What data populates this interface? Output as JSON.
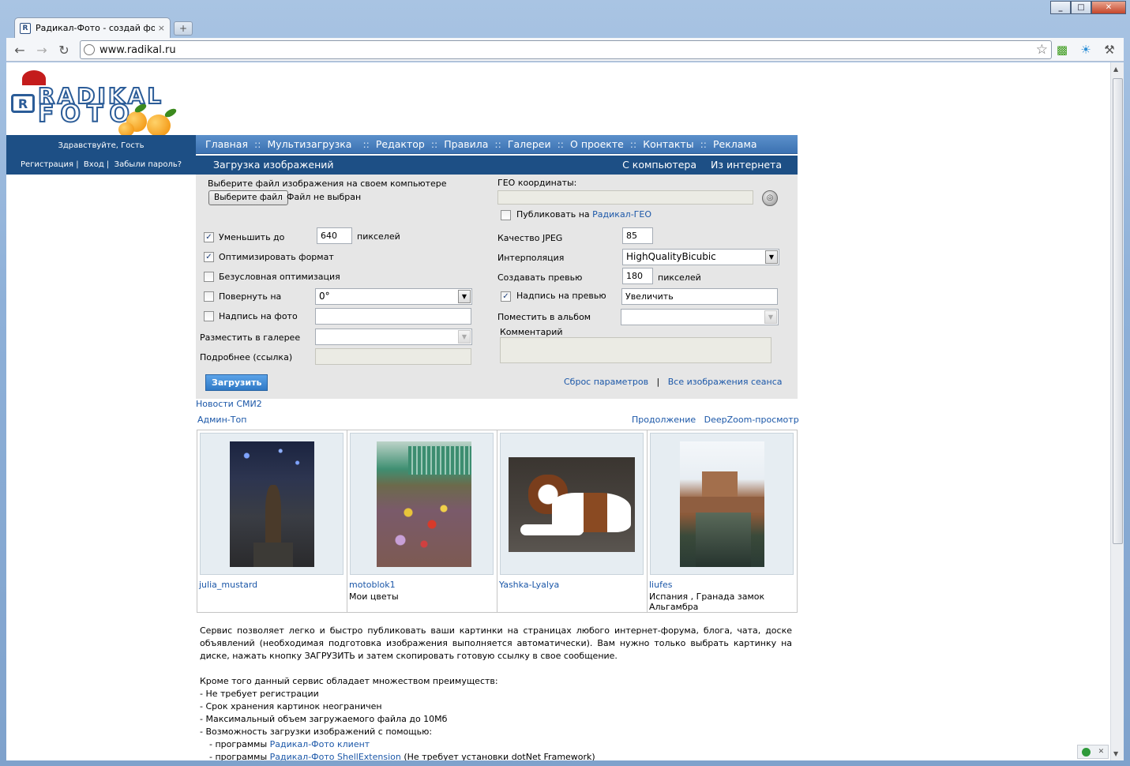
{
  "browser": {
    "tab_title": "Радикал-Фото - создай фо",
    "tab_close": "×",
    "newtab": "+",
    "url": "www.radikal.ru",
    "win_min": "_",
    "win_max": "□",
    "win_close": "✕"
  },
  "icons": {
    "back": "arrow-left-icon",
    "forward": "arrow-right-icon",
    "reload": "reload-icon",
    "star": "bookmark-star-icon",
    "wrench": "wrench-icon"
  },
  "header": {
    "greeting": "Здравствуйте, Гость",
    "register": "Регистрация",
    "login": "Вход",
    "forgot": "Забыли пароль?",
    "sep": "|"
  },
  "topnav": [
    "Главная",
    "Мультизагрузка",
    "Редактор",
    "Правила",
    "Галереи",
    "О проекте",
    "Контакты",
    "Реклама"
  ],
  "topnav_sep": "::",
  "subnav": {
    "title": "Загрузка изображений",
    "from_computer": "С компьютера",
    "from_internet": "Из интернета"
  },
  "form": {
    "choose_label": "Выберите файл изображения на своем компьютере",
    "choose_button": "Выберите файл",
    "no_file": "Файл не выбран",
    "resize_label": "Уменьшить до",
    "resize_value": "640",
    "pixels": "пикселей",
    "optimize_format": "Оптимизировать формат",
    "force_optimize": "Безусловная оптимизация",
    "rotate_label": "Повернуть на",
    "rotate_value": "0°",
    "caption_label": "Надпись на фото",
    "gallery_label": "Разместить в галерее",
    "details_label": "Подробнее (ссылка)",
    "upload_button": "Загрузить",
    "geo_label": "ГЕО координаты:",
    "publish_geo": "Публиковать на",
    "publish_geo_link": "Радикал-ГЕО",
    "jpeg_label": "Качество JPEG",
    "jpeg_value": "85",
    "interp_label": "Интерполяция",
    "interp_value": "HighQualityBicubic",
    "preview_label": "Создавать превью",
    "preview_value": "180",
    "preview_caption_label": "Надпись на превью",
    "preview_caption_value": "Увеличить",
    "album_label": "Поместить в альбом",
    "comment_label": "Комментарий",
    "reset_link": "Сброс параметров",
    "all_images_link": "Все изображения сеанса",
    "links_sep": "|",
    "check": "✓"
  },
  "news_link": "Новости СМИ2",
  "admin_top": "Админ-Топ",
  "continue_link": "Продолжение",
  "deepzoom_link": "DeepZoom-просмотр",
  "gallery": [
    {
      "author": "julia_mustard",
      "caption": ""
    },
    {
      "author": "motoblok1",
      "caption": "Мои цветы"
    },
    {
      "author": "Yashka-Lyalya",
      "caption": ""
    },
    {
      "author": "liufes",
      "caption": "Испания , Гранада замок Альгамбра"
    }
  ],
  "description": {
    "p1": "Сервис позволяет легко и быстро публиковать ваши картинки на страницах любого интернет-форума, блога, чата, доске объявлений (необходимая подготовка изображения выполняется автоматически). Вам нужно только выбрать картинку на диске, нажать кнопку ЗАГРУЗИТЬ и затем скопировать готовую ссылку в свое сообщение.",
    "p2": "Кроме того данный сервис обладает множеством преимуществ:",
    "li1": "- Не требует регистрации",
    "li2": "- Срок хранения картинок неограничен",
    "li3": "- Максимальный объем загружаемого файла до 10Мб",
    "li4": "- Возможность загрузки изображений с помощью:",
    "sub1_prefix": "- программы",
    "sub1_link": "Радикал-Фото клиент",
    "sub2_prefix": "- программы",
    "sub2_link": "Радикал-Фото ShellExtension",
    "sub2_suffix": "(Не требует установки dotNet Framework)"
  },
  "logo_text": {
    "line1": "RADIKAL",
    "line2": "FOTO",
    "badge": "R"
  },
  "colors": {
    "nav_blue": "#3c72b2",
    "dark_blue": "#1d4f85",
    "link": "#1b57a8",
    "form_bg": "#e6e6e6"
  }
}
